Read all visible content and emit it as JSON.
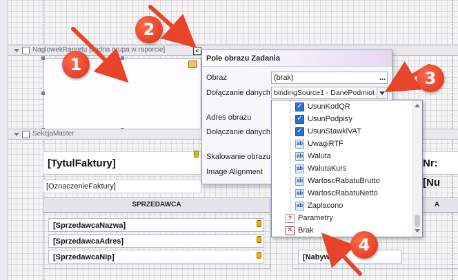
{
  "bands": {
    "header_label": "NaglowekRaportu [Jedna grupa w raporcie]",
    "master_label": "SekcjaMaster"
  },
  "report": {
    "title_field": "[TytulFaktury]",
    "invoice_no_field": "Nr: [Nu",
    "designation_field": "[OznaczenieFaktury]",
    "seller_header": "SPRZEDAWCA",
    "buyer_header_partial": "A",
    "seller_fields": [
      "[SprzedawcaNazwa]",
      "[SprzedawcaAdres]",
      "[SprzedawcaNip]"
    ],
    "buyer_field_partial": "[Nabywca"
  },
  "popup": {
    "title": "Pole obrazu Zadania",
    "rows": [
      {
        "label": "Obraz",
        "value": "(brak)"
      },
      {
        "label": "Dołączanie danych",
        "value": "bindingSource1 - DanePodmiot"
      },
      {
        "label": "Adres obrazu",
        "value": ""
      },
      {
        "label": "Dołączanie danych",
        "value": ""
      },
      {
        "label": "Skalowanie obrazu",
        "value": ""
      },
      {
        "label": "Image Alignment",
        "value": ""
      }
    ],
    "ellipsis": "..."
  },
  "dropdown": {
    "items": [
      {
        "label": "UsunKodQR",
        "icon": "checkbox-icon"
      },
      {
        "label": "UsunPodpisy",
        "icon": "checkbox-icon"
      },
      {
        "label": "UsunStawkiVAT",
        "icon": "checkbox-icon"
      },
      {
        "label": "UwagiRTF",
        "icon": "text-field-icon"
      },
      {
        "label": "Waluta",
        "icon": "text-field-icon"
      },
      {
        "label": "WalutaKurs",
        "icon": "text-field-icon"
      },
      {
        "label": "WartoscRabatuBrutto",
        "icon": "text-field-icon"
      },
      {
        "label": "WartoscRabatuNetto",
        "icon": "text-field-icon"
      },
      {
        "label": "Zaplacono",
        "icon": "text-field-icon"
      },
      {
        "label": "Parametry",
        "icon": "parameters-icon"
      },
      {
        "label": "Brak",
        "icon": "none-icon"
      }
    ]
  },
  "annotations": [
    "1",
    "2",
    "3",
    "4"
  ],
  "colors": {
    "annotation_red": "#e8442a",
    "selection_blue": "#6a7fb0",
    "popup_border": "#9aa3bd"
  }
}
